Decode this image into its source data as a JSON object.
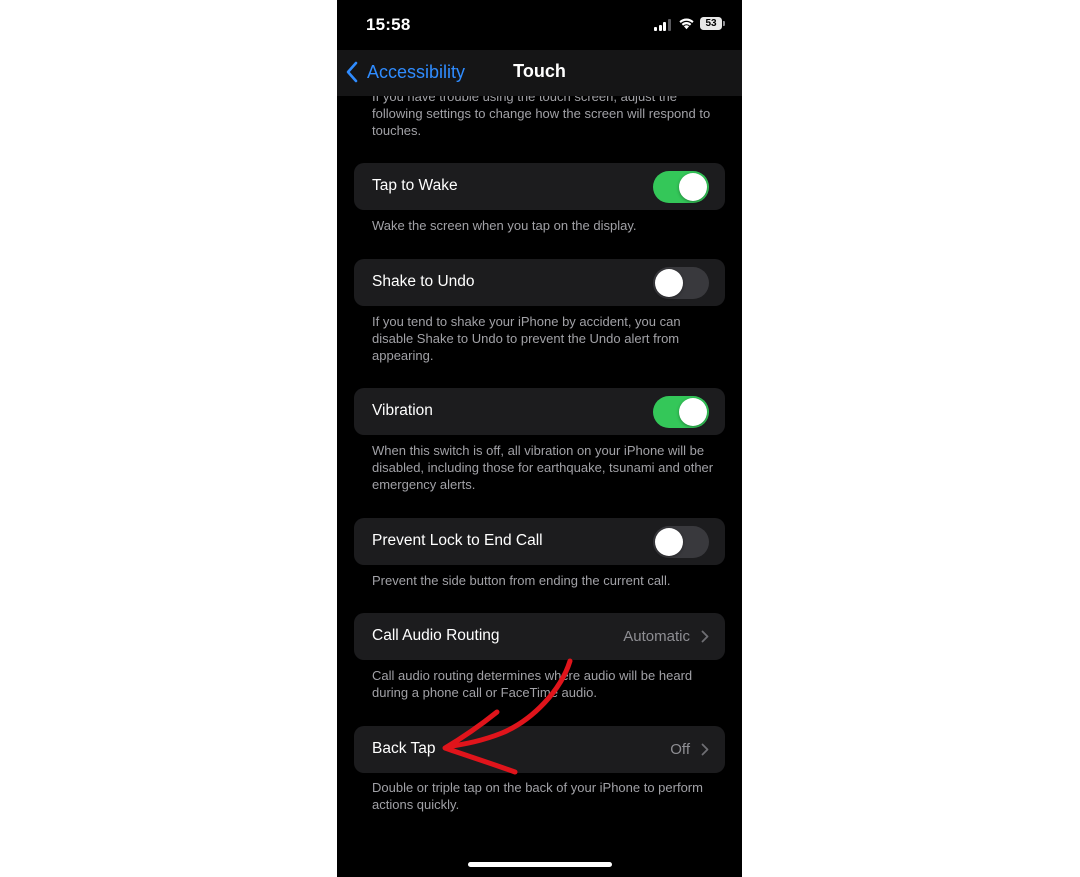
{
  "status_bar": {
    "time": "15:58",
    "battery": "53"
  },
  "nav": {
    "back_label": "Accessibility",
    "title": "Touch"
  },
  "intro": "If you have trouble using the touch screen, adjust the following settings to change how the screen will respond to touches.",
  "settings": [
    {
      "label": "Tap to Wake",
      "type": "toggle",
      "on": true,
      "footer": "Wake the screen when you tap on the display."
    },
    {
      "label": "Shake to Undo",
      "type": "toggle",
      "on": false,
      "footer": "If you tend to shake your iPhone by accident, you can disable Shake to Undo to prevent the Undo alert from appearing."
    },
    {
      "label": "Vibration",
      "type": "toggle",
      "on": true,
      "footer": "When this switch is off, all vibration on your iPhone will be disabled, including those for earthquake, tsunami and other emergency alerts."
    },
    {
      "label": "Prevent Lock to End Call",
      "type": "toggle",
      "on": false,
      "footer": "Prevent the side button from ending the current call."
    },
    {
      "label": "Call Audio Routing",
      "type": "link",
      "value": "Automatic",
      "footer": "Call audio routing determines where audio will be heard during a phone call or FaceTime audio."
    },
    {
      "label": "Back Tap",
      "type": "link",
      "value": "Off",
      "footer": "Double or triple tap on the back of your iPhone to perform actions quickly."
    }
  ],
  "icons": {
    "back": "chevron-left-icon",
    "disclosure": "chevron-right-icon",
    "signal": "cellular-signal-icon",
    "wifi": "wifi-icon",
    "battery": "battery-icon",
    "annotation": "red-arrow-annotation"
  },
  "colors": {
    "background": "#000000",
    "cell": "#1c1c1e",
    "accent": "#2f8cff",
    "toggle_on": "#34c759",
    "toggle_off": "#39393d",
    "secondary_text": "#a1a1a6",
    "annotation": "#e0141b"
  }
}
